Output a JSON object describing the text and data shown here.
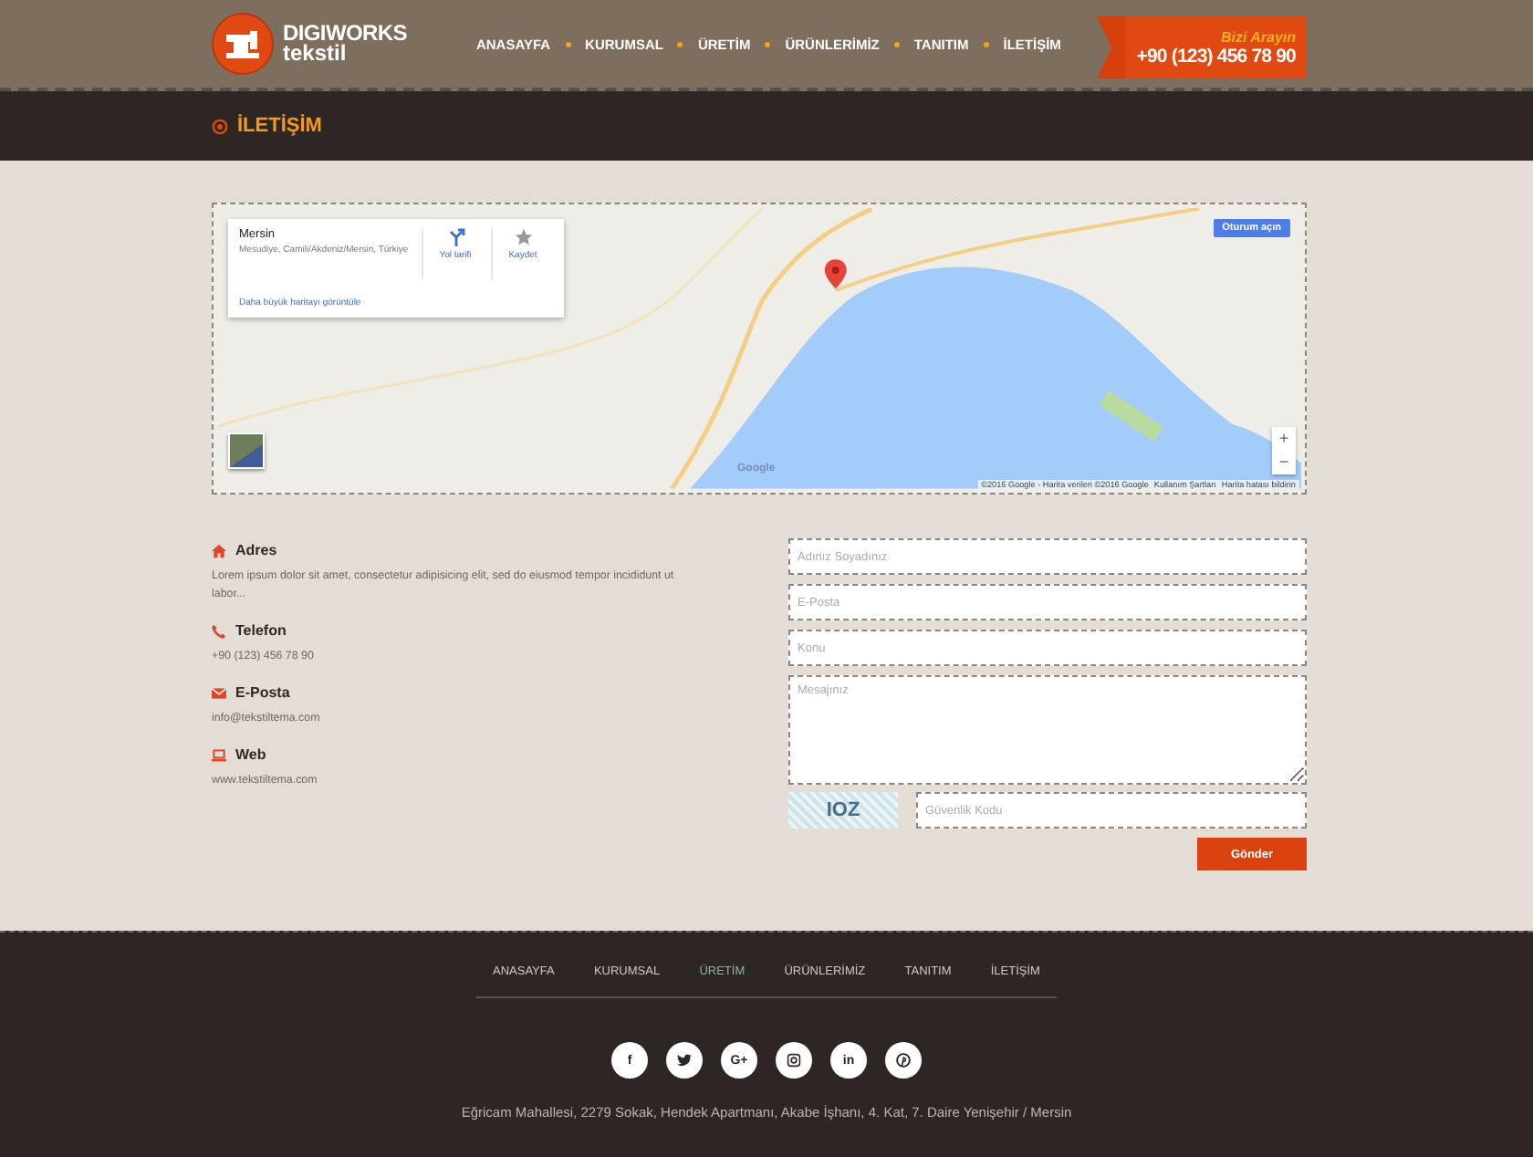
{
  "header": {
    "logo": {
      "line1": "DIGIWORKS",
      "line2": "tekstil"
    },
    "nav": [
      {
        "label": "ANASAYFA",
        "selected": false
      },
      {
        "label": "KURUMSAL",
        "selected": false
      },
      {
        "label": "ÜRETİM",
        "selected": false
      },
      {
        "label": "ÜRÜNLERİMİZ",
        "selected": false
      },
      {
        "label": "TANITIM",
        "selected": false
      },
      {
        "label": "İLETİŞİM",
        "selected": false
      }
    ],
    "call_box": {
      "label": "Bizi Arayın",
      "phone": "+90 (123) 456 78 90"
    }
  },
  "page_title": "İLETİŞİM",
  "map": {
    "info_card": {
      "title": "Mersin",
      "address": "Mesudiye, Camili/Akdeniz/Mersin, Türkiye",
      "directions": "Yol tarifi",
      "save": "Kaydet",
      "larger_map": "Daha büyük haritayı görüntüle"
    },
    "sign_in": "Oturum açın",
    "zoom_in": "+",
    "zoom_out": "−",
    "logo": "Google",
    "attribution": [
      "©2016 Google - Harita verileri ©2016 Google",
      "Kullanım Şartları",
      "Harita hatası bildirin"
    ]
  },
  "contact_items": [
    {
      "kind": "address",
      "title": "Adres",
      "text": "Lorem ipsum dolor sit amet, consectetur adipisicing elit, sed do eiusmod tempor incididunt ut labor..."
    },
    {
      "kind": "phone",
      "title": "Telefon",
      "text": "+90 (123) 456 78 90"
    },
    {
      "kind": "email",
      "title": "E-Posta",
      "text": "info@tekstiltema.com"
    },
    {
      "kind": "web",
      "title": "Web",
      "text": "www.tekstiltema.com"
    }
  ],
  "form": {
    "fields": [
      {
        "kind": "input",
        "placeholder": "Adınız Soyadınız"
      },
      {
        "kind": "input",
        "placeholder": "E-Posta"
      },
      {
        "kind": "input",
        "placeholder": "Konu"
      },
      {
        "kind": "textarea",
        "placeholder": "Mesajınız"
      }
    ],
    "captcha_text": "IOZ",
    "captcha_placeholder": "Güvenlik Kodu",
    "submit": "Gönder"
  },
  "footer": {
    "nav": [
      {
        "label": "ANASAYFA",
        "selected": false
      },
      {
        "label": "KURUMSAL",
        "selected": false
      },
      {
        "label": "ÜRETİM",
        "selected": true
      },
      {
        "label": "ÜRÜNLERİMİZ",
        "selected": false
      },
      {
        "label": "TANITIM",
        "selected": false
      },
      {
        "label": "İLETİŞİM",
        "selected": false
      }
    ],
    "social": [
      {
        "kind": "facebook",
        "label": "f"
      },
      {
        "kind": "twitter"
      },
      {
        "kind": "googleplus",
        "label": "G+"
      },
      {
        "kind": "instagram"
      },
      {
        "kind": "linkedin",
        "label": "in"
      },
      {
        "kind": "pinterest"
      }
    ],
    "address": "Eğricam Mahallesi, 2279 Sokak, Hendek Apartmanı, Akabe İşhanı, 4. Kat, 7. Daire Yenişehir / Mersin"
  }
}
